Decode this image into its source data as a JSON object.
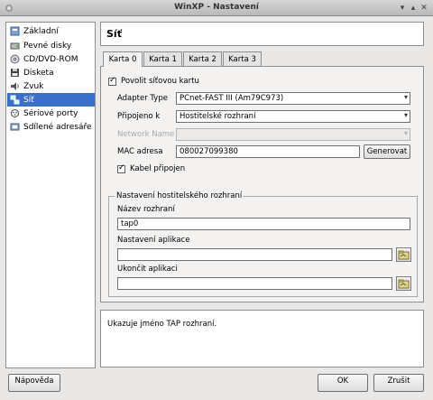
{
  "window": {
    "title": "WinXP - Nastavení"
  },
  "sidebar": {
    "items": [
      {
        "label": "Základní",
        "icon": "settings-icon"
      },
      {
        "label": "Pevné disky",
        "icon": "hard-disk-icon"
      },
      {
        "label": "CD/DVD-ROM",
        "icon": "cd-icon"
      },
      {
        "label": "Disketa",
        "icon": "floppy-icon"
      },
      {
        "label": "Zvuk",
        "icon": "speaker-icon"
      },
      {
        "label": "Síť",
        "icon": "network-icon",
        "selected": true
      },
      {
        "label": "Sériové porty",
        "icon": "serial-port-icon"
      },
      {
        "label": "Sdílené adresáře",
        "icon": "shared-folder-icon"
      }
    ]
  },
  "header": {
    "title": "Síť"
  },
  "tabs": [
    {
      "label": "Karta 0",
      "active": true
    },
    {
      "label": "Karta 1"
    },
    {
      "label": "Karta 2"
    },
    {
      "label": "Karta 3"
    }
  ],
  "adapter": {
    "enable_label": "Povolit síťovou kartu",
    "enable_checked": true,
    "type_label": "Adapter Type",
    "type_value": "PCnet-FAST III (Am79C973)",
    "attached_label": "Připojeno k",
    "attached_value": "Hostitelské rozhraní",
    "network_name_label": "Network Name",
    "network_name_value": "",
    "mac_label": "MAC adresa",
    "mac_value": "080027099380",
    "generate_label": "Generovat",
    "cable_label": "Kabel připojen",
    "cable_checked": true
  },
  "host_interface": {
    "legend": "Nastavení hostitelského rozhraní",
    "name_label": "Název rozhraní",
    "name_value": "tap0",
    "setup_label": "Nastavení aplikace",
    "setup_value": "",
    "teardown_label": "Ukončit aplikaci",
    "teardown_value": ""
  },
  "description": "Ukazuje jméno TAP rozhraní.",
  "footer": {
    "help_label": "Nápověda",
    "ok_label": "OK",
    "cancel_label": "Zrušit"
  }
}
